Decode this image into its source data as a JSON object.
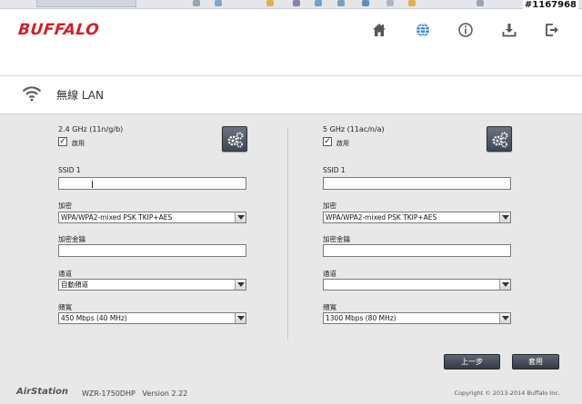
{
  "watermark": "#1167968",
  "header": {
    "logo": "BUFFALO",
    "nav": [
      {
        "name": "home-icon"
      },
      {
        "name": "globe-icon"
      },
      {
        "name": "info-icon"
      },
      {
        "name": "download-icon"
      },
      {
        "name": "logout-icon"
      }
    ],
    "accent_color": "#d71d24"
  },
  "page": {
    "title": "無線 LAN"
  },
  "panels": [
    {
      "band": "2.4 GHz (11n/g/b)",
      "enable_label": "啟用",
      "enabled": true,
      "ssid_label": "SSID 1",
      "ssid_value": "",
      "encryption_label": "加密",
      "encryption_value": "WPA/WPA2-mixed PSK TKIP+AES",
      "key_label": "加密金鑰",
      "key_value": "",
      "channel_label": "通道",
      "channel_value": "自動頻道",
      "bandwidth_label": "頻寬",
      "bandwidth_value": "450 Mbps (40 MHz)"
    },
    {
      "band": "5 GHz (11ac/n/a)",
      "enable_label": "啟用",
      "enabled": true,
      "ssid_label": "SSID 1",
      "ssid_value": "",
      "encryption_label": "加密",
      "encryption_value": "WPA/WPA2-mixed PSK TKIP+AES",
      "key_label": "加密金鑰",
      "key_value": "",
      "channel_label": "通道",
      "channel_value": "",
      "bandwidth_label": "頻寬",
      "bandwidth_value": "1300 Mbps (80 MHz)"
    }
  ],
  "buttons": {
    "back": "上一步",
    "apply": "套用"
  },
  "footer": {
    "brand": "AirStation",
    "model": "WZR-1750DHP   Version 2.22",
    "copyright": "Copyright © 2013-2014 Buffalo Inc."
  }
}
